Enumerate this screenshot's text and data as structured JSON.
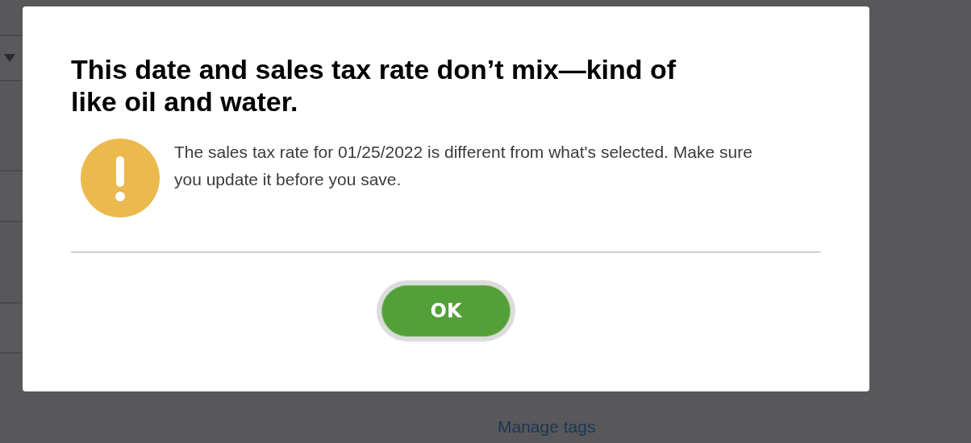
{
  "background": {
    "link": "Manage tags"
  },
  "dialog": {
    "title": "This date and sales tax rate don’t mix—kind of like oil and water.",
    "message": "The sales tax rate for 01/25/2022 is different from what's selected. Make sure you update it before you save.",
    "buttons": [
      {
        "label": "OK",
        "kind": "primary"
      }
    ]
  }
}
